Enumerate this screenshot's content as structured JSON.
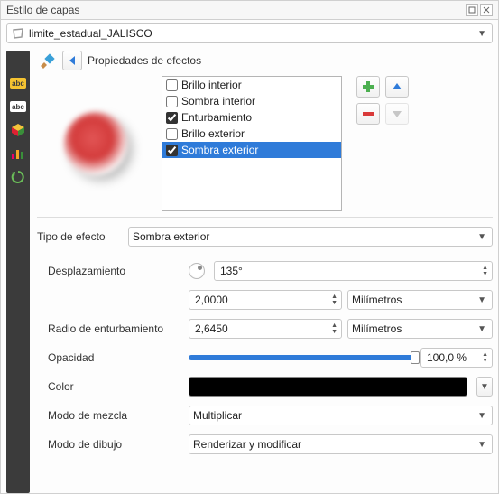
{
  "title": "Estilo de capas",
  "layer_selector": {
    "value": "limite_estadual_JALISCO"
  },
  "effects_header": "Propiedades de efectos",
  "effects_list": [
    {
      "label": "Brillo interior",
      "checked": false,
      "selected": false
    },
    {
      "label": "Sombra interior",
      "checked": false,
      "selected": false
    },
    {
      "label": "Enturbamiento",
      "checked": true,
      "selected": false
    },
    {
      "label": "Brillo exterior",
      "checked": false,
      "selected": false
    },
    {
      "label": "Sombra exterior",
      "checked": true,
      "selected": true
    }
  ],
  "form": {
    "effect_type_label": "Tipo de efecto",
    "effect_type_value": "Sombra exterior",
    "offset_label": "Desplazamiento",
    "offset_angle": "135°",
    "offset_distance": "2,0000",
    "offset_distance_unit": "Milímetros",
    "blur_label": "Radio de enturbamiento",
    "blur_value": "2,6450",
    "blur_unit": "Milímetros",
    "opacity_label": "Opacidad",
    "opacity_value": "100,0 %",
    "opacity_percent": 100,
    "color_label": "Color",
    "color_value": "#000000",
    "blend_label": "Modo de mezcla",
    "blend_value": "Multiplicar",
    "draw_label": "Modo de dibujo",
    "draw_value": "Renderizar y modificar"
  }
}
